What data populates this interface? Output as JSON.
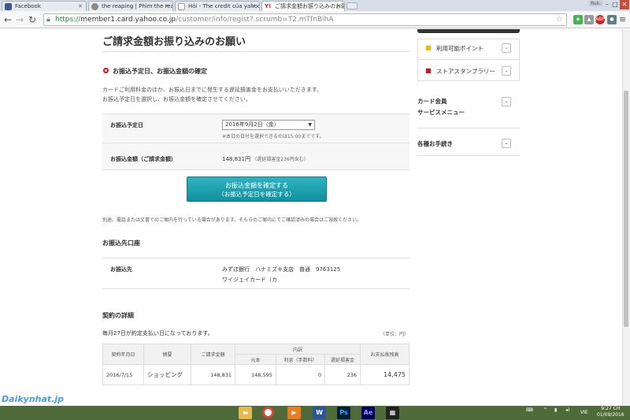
{
  "browser": {
    "tabs": [
      {
        "label": "Facebook",
        "active": false
      },
      {
        "label": "the reaping | Phim the rea",
        "active": false
      },
      {
        "label": "Hỏi - The credit của yahoo",
        "active": false
      },
      {
        "label": "ご請求金額お振り込みのお願",
        "active": true
      }
    ],
    "user_badge": "Ruk.",
    "url_scheme": "https://",
    "url_host": "member1.card.yahoo.co.jp",
    "url_path": "/customer/info/regist?.scrumb=T2.mTfnBihA",
    "ext_abp": "ABP"
  },
  "page": {
    "title": "ご請求金額お振り込みのお願い",
    "section_heading": "お振込予定日、お振込金額の確定",
    "desc_line1": "カードご利用料金のほか、お振込日までに発生する遅延損害金をお支払いいただきます。",
    "desc_line2": "お振込予定日を選択し、お振込金額を確定させてください。",
    "form": {
      "date_label": "お振込予定日",
      "date_value": "2016年9月2日（金）",
      "date_note": "※本日の日付を選択できるのは15:00までです。",
      "amount_label": "お振込金額（ご請求金額）",
      "amount_value": "148,831円",
      "amount_note": "（遅延損害金236円含む）"
    },
    "confirm_button_line1": "お振込金額を確定する",
    "confirm_button_line2": "（お振込予定日を確定する）",
    "notice": "別途、電話または文書でのご案内を行っている場合があります。そちらのご案内にてご確認済みの場合はご容赦ください。",
    "account_heading": "お振込先口座",
    "account": {
      "label": "お振込先",
      "line1": "みずほ銀行　ハナミズキ支店　普通　9763125",
      "line2": "ワイジェイカード（カ"
    },
    "contract_heading": "契約の詳細",
    "contract_intro": "毎月27日が約定支払い日になっております。",
    "contract_unit": "（単位：円）",
    "table": {
      "headers": {
        "date": "契約年月日",
        "type": "摘要",
        "billed": "ご請求金額",
        "breakdown": "内訳",
        "principal": "元本",
        "interest": "利息（手数料）",
        "late_fee": "遅延損害金",
        "remaining": "お支払後残高"
      },
      "row": {
        "date": "2016/7/15",
        "type": "ショッピング",
        "billed": "148,831",
        "principal": "148,595",
        "interest": "0",
        "late_fee": "236",
        "remaining": "14,475"
      }
    }
  },
  "sidebar": {
    "points": "利用可能ポイント",
    "stamp": "ストアスタンプラリー",
    "service_line1": "カード会員",
    "service_line2": "サービスメニュー",
    "procedures": "各種お手続き"
  },
  "taskbar": {
    "lang": "VIE",
    "time": "9:27 CH",
    "date": "01/09/2016"
  },
  "watermark": "Daikynhat.jp"
}
